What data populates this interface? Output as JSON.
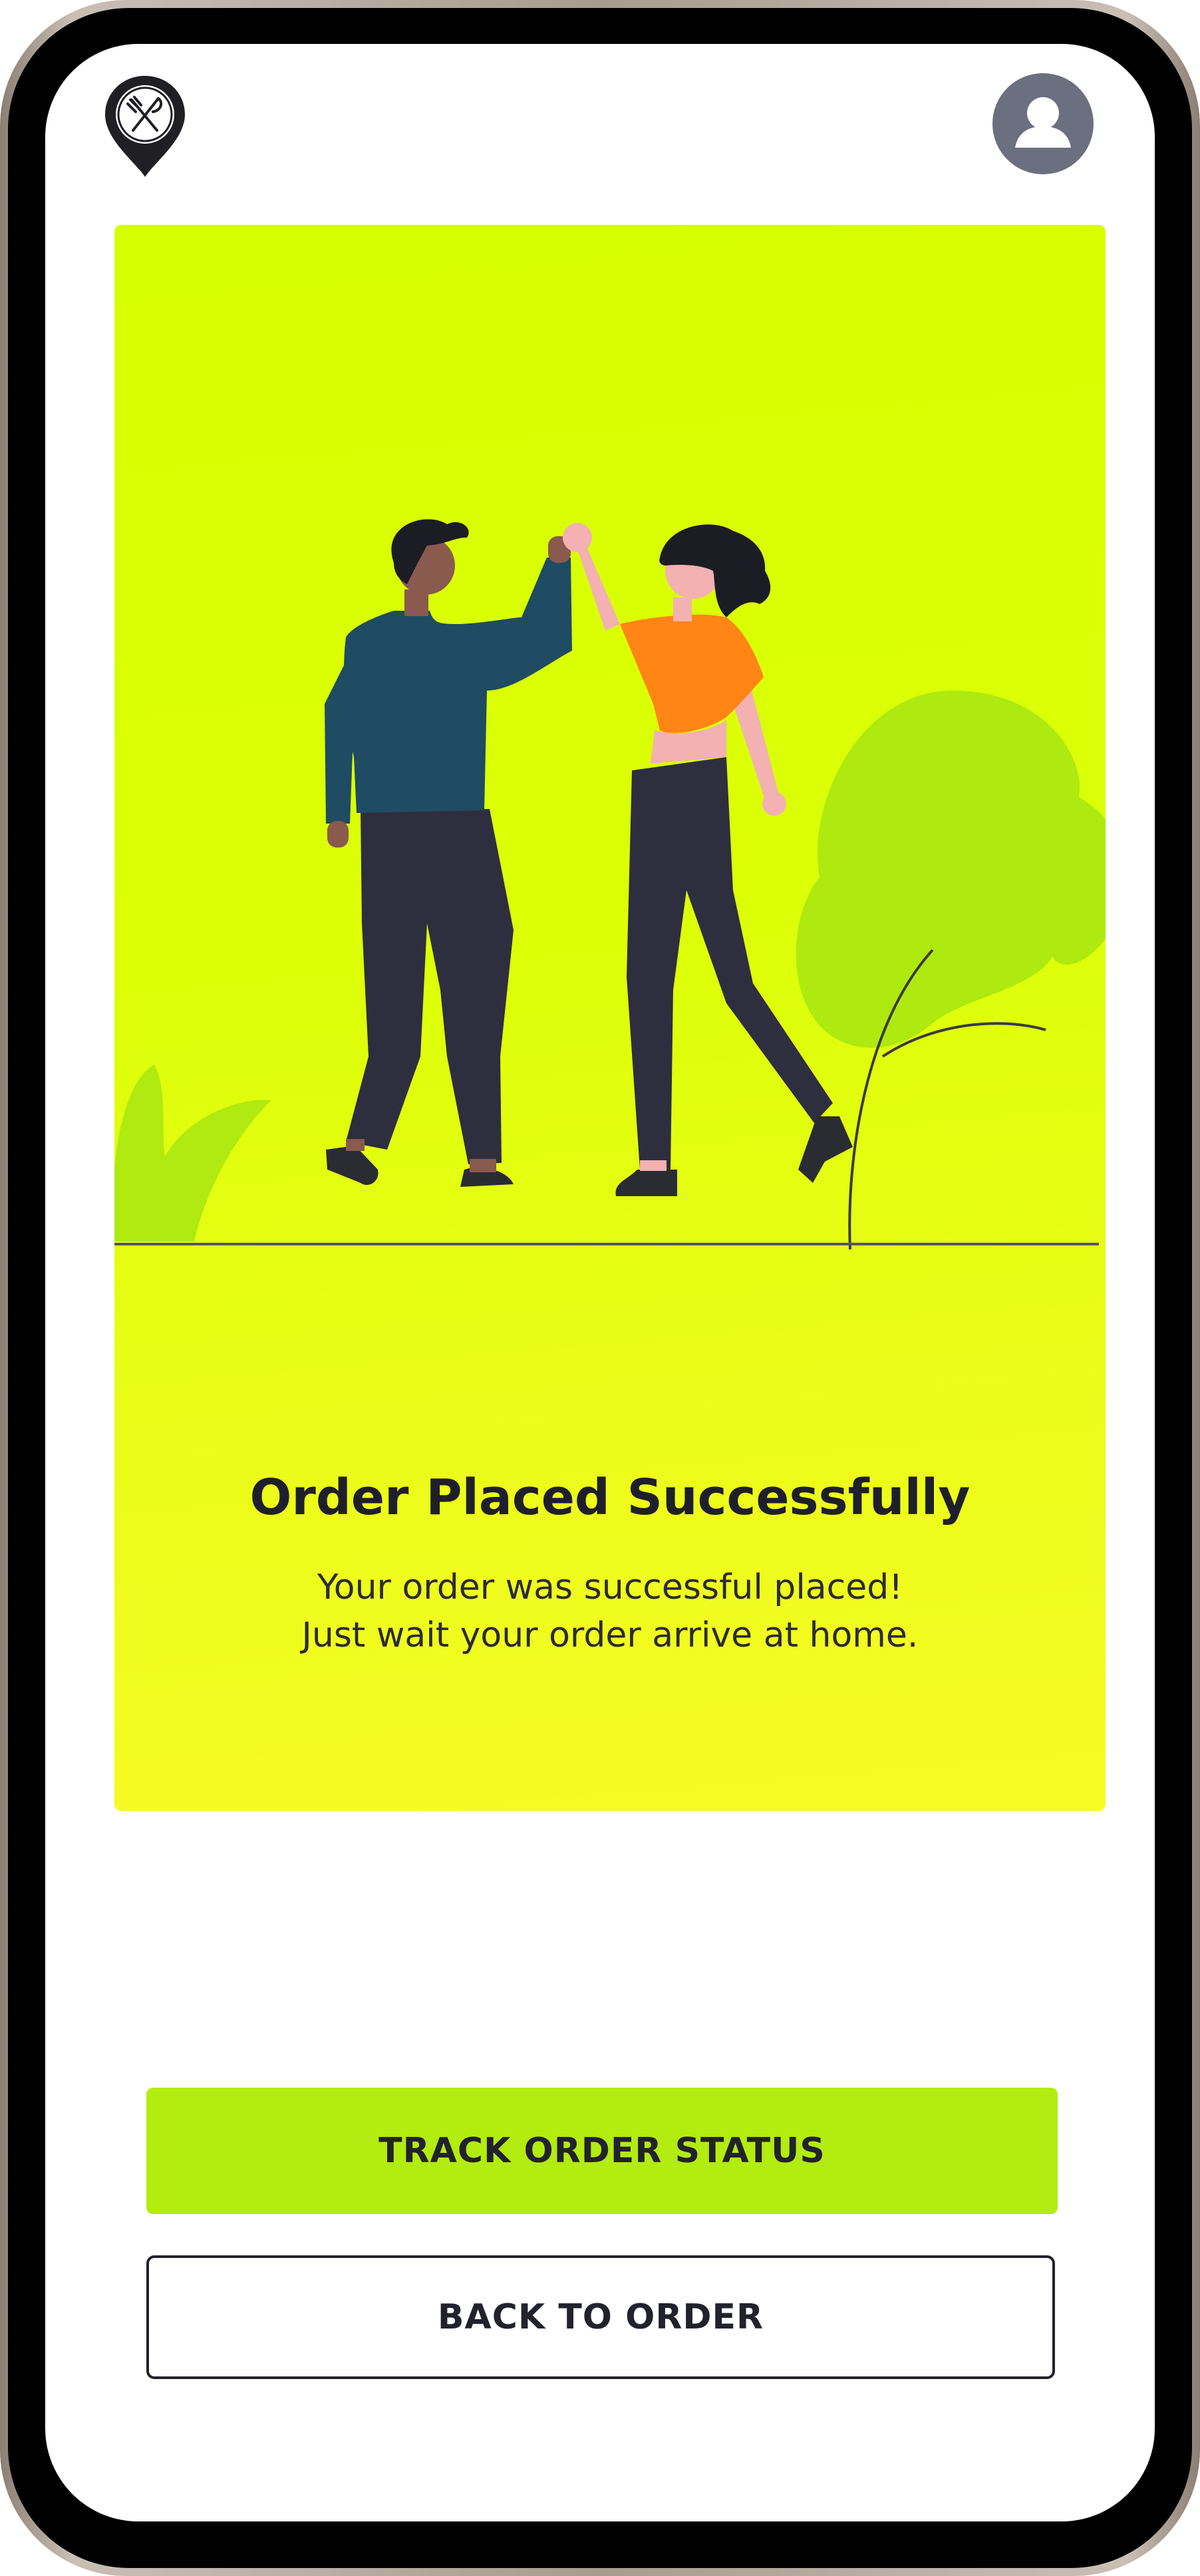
{
  "header": {
    "logo_icon": "restaurant-pin-icon",
    "profile_icon": "user-avatar-icon"
  },
  "hero": {
    "title": "Order Placed Successfully",
    "description_line1": "Your order was successful placed!",
    "description_line2": "Just wait your order arrive at home.",
    "illustration": "two-people-high-five-illustration"
  },
  "actions": {
    "track_label": "TRACK ORDER STATUS",
    "back_label": "BACK TO ORDER"
  },
  "colors": {
    "accent": "#b2ec10",
    "hero_background": "#d6ff00",
    "text_dark": "#22222c",
    "avatar_bg": "#6c6f80"
  }
}
